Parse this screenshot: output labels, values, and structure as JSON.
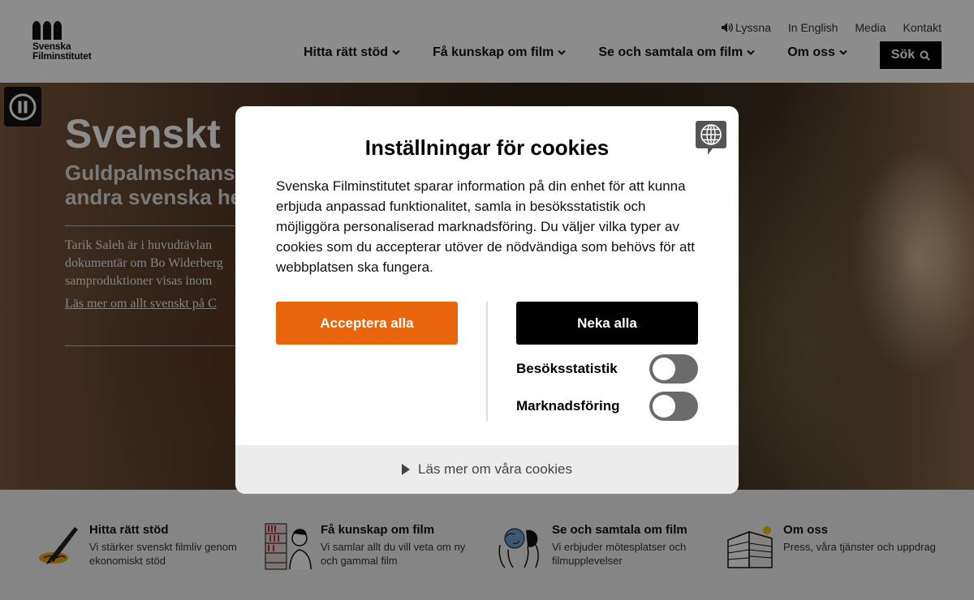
{
  "header": {
    "logo_line1": "Svenska",
    "logo_line2": "Filminstitutet",
    "utility": {
      "listen": "Lyssna",
      "english": "In English",
      "media": "Media",
      "contact": "Kontakt"
    },
    "nav": [
      {
        "label": "Hitta rätt stöd"
      },
      {
        "label": "Få kunskap om film"
      },
      {
        "label": "Se och samtala om film"
      },
      {
        "label": "Om oss"
      }
    ],
    "search_label": "Sök"
  },
  "hero": {
    "title": "Svenskt",
    "subtitle_line1": "Guldpalmschans",
    "subtitle_line2": "andra svenska he",
    "text_line1": "Tarik Saleh är i huvudtävlan",
    "text_line2": "dokumentär om Bo Widerberg",
    "text_line3": "samproduktioner visas inom",
    "link": "Läs mer om allt svenskt på C"
  },
  "cookie_dialog": {
    "title": "Inställningar för cookies",
    "body": "Svenska Filminstitutet sparar information på din enhet för att kunna erbjuda anpassad funktionalitet, samla in besöksstatistik och möjliggöra personaliserad marknadsföring. Du väljer vilka typer av cookies som du accepterar utöver de nödvändiga som behövs för att webbplatsen ska fungera.",
    "accept_all": "Acceptera alla",
    "deny_all": "Neka alla",
    "toggles": [
      {
        "label": "Besöksstatistik",
        "on": false
      },
      {
        "label": "Marknadsföring",
        "on": false
      }
    ],
    "read_more": "Läs mer om våra cookies"
  },
  "categories": [
    {
      "title": "Hitta rätt stöd",
      "desc": "Vi stärker svenskt filmliv genom ekonomiskt stöd",
      "icon": "pen-illustration"
    },
    {
      "title": "Få kunskap om film",
      "desc": "Vi samlar allt du vill veta om ny och gammal film",
      "icon": "library-illustration"
    },
    {
      "title": "Se och samtala om film",
      "desc": "Vi erbjuder mötesplatser och filmupplevelser",
      "icon": "people-illustration"
    },
    {
      "title": "Om oss",
      "desc": "Press, våra tjänster och uppdrag",
      "icon": "building-illustration"
    }
  ],
  "colors": {
    "accent": "#e8650c",
    "dark": "#000000",
    "toggle_off": "#6b6b6b"
  }
}
